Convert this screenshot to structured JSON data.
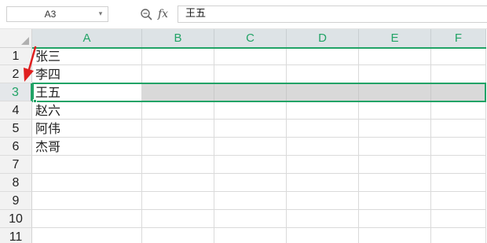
{
  "formula_bar": {
    "name_box": "A3",
    "fx_label": "fx",
    "formula_value": "王五"
  },
  "columns": [
    "A",
    "B",
    "C",
    "D",
    "E",
    "F"
  ],
  "rows": [
    "1",
    "2",
    "3",
    "4",
    "5",
    "6",
    "7",
    "8",
    "9",
    "10",
    "11"
  ],
  "cells_A": [
    "张三",
    "李四",
    "王五",
    "赵六",
    "阿伟",
    "杰哥",
    "",
    "",
    "",
    "",
    ""
  ],
  "selection": {
    "active_cell": "A3",
    "selected_row": "3",
    "accent_color": "#21a366"
  },
  "annotation": {
    "type": "red-arrow",
    "color": "#e02020",
    "points_to": "row-header-2"
  },
  "icons": {
    "name_box_dropdown": "chevron-down-icon",
    "zoom": "zoom-search-icon",
    "fx": "function-icon"
  }
}
